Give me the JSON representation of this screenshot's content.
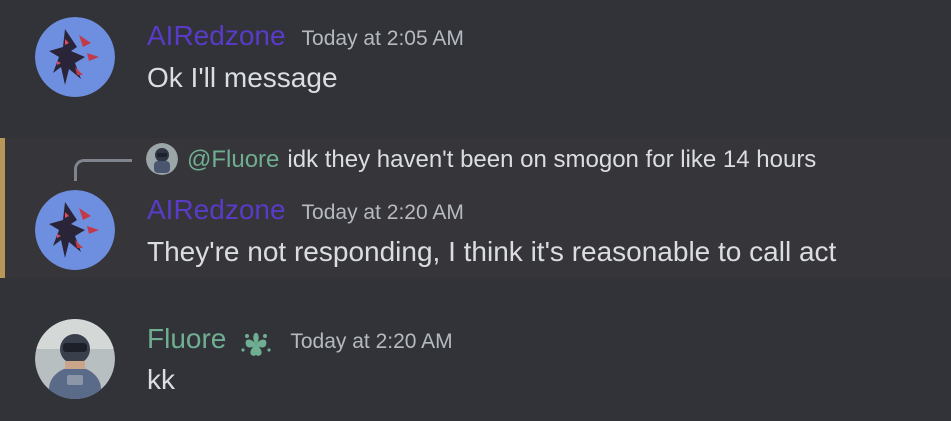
{
  "colors": {
    "background": "#313338",
    "highlight_background": "#36353a",
    "mention_bar": "#b9955a",
    "airedzone_name": "#5a3bc7",
    "fluore_name": "#6fae91",
    "timestamp": "#b5bac1",
    "text": "#dbdee1"
  },
  "messages": [
    {
      "author": "AIRedzone",
      "timestamp": "Today at 2:05 AM",
      "content": "Ok I'll message",
      "avatar": "redzone-avatar"
    },
    {
      "reply": {
        "user": "@Fluore",
        "text": "idk they haven't been on smogon for like 14 hours",
        "avatar": "fluore-avatar"
      },
      "author": "AIRedzone",
      "timestamp": "Today at 2:20 AM",
      "content": "They're not responding, I think it's reasonable to call act",
      "avatar": "redzone-avatar",
      "highlighted": true
    },
    {
      "author": "Fluore",
      "role_icon": "clover-heart-icon",
      "timestamp": "Today at 2:20 AM",
      "content": "kk",
      "avatar": "fluore-avatar"
    }
  ]
}
